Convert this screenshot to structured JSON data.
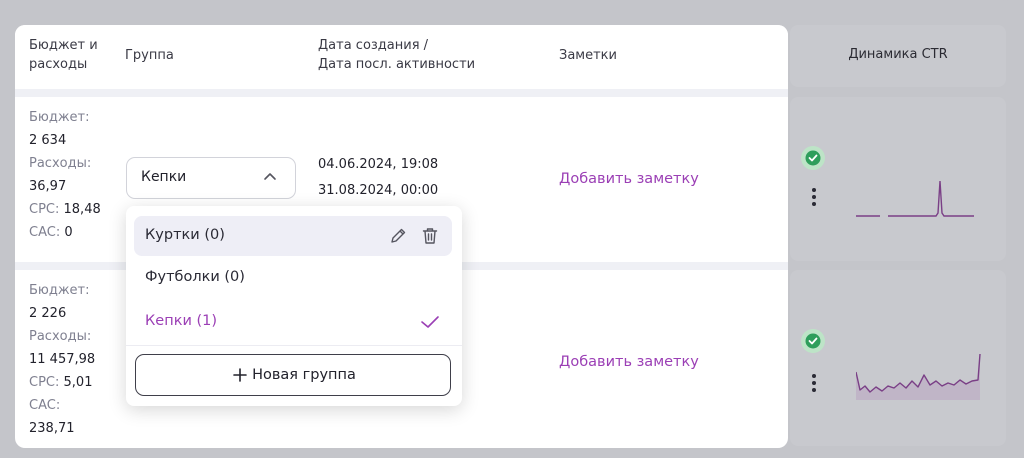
{
  "header": {
    "budget_col": "Бюджет и расходы",
    "budget_col_l1": "Бюджет и",
    "budget_col_l2": "расходы",
    "group_col": "Группа",
    "date_col_l1": "Дата создания /",
    "date_col_l2": "Дата посл. активности",
    "notes_col": "Заметки",
    "ctr_col": "Динамика CTR"
  },
  "rows": [
    {
      "budget_label": "Бюджет:",
      "budget_value": "2 634",
      "spend_label": "Расходы:",
      "spend_value": "36,97",
      "cpc_label": "CPC:",
      "cpc_value": "18,48",
      "cac_label": "CAC:",
      "cac_value": "0",
      "group": "Кепки",
      "created": "04.06.2024, 19:08",
      "last_active": "31.08.2024, 00:00",
      "note": "Добавить заметку"
    },
    {
      "budget_label": "Бюджет:",
      "budget_value": "2 226",
      "spend_label": "Расходы:",
      "spend_value": "11 457,98",
      "cpc_label": "CPC:",
      "cpc_value": "5,01",
      "cac_label": "CAC:",
      "cac_value": "238,71",
      "note": "Добавить заметку"
    }
  ],
  "dropdown": {
    "options": [
      {
        "label": "Куртки (0)",
        "highlighted": true
      },
      {
        "label": "Футболки (0)"
      },
      {
        "label": "Кепки (1)",
        "selected": true
      }
    ],
    "new_group_label": "Новая группа"
  },
  "colors": {
    "accent": "#9b3fb5",
    "status_green": "#2e9e5b",
    "sparkline": "#7a3f86"
  }
}
